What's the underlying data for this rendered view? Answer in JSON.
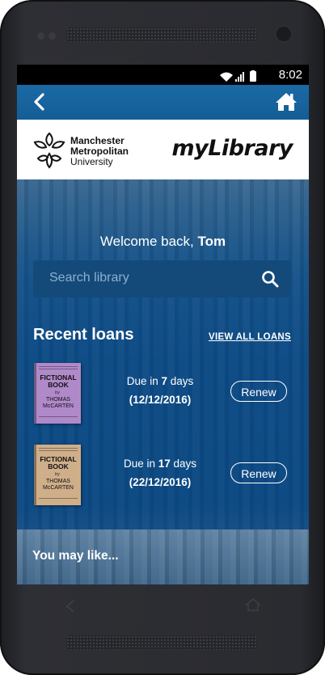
{
  "status_bar": {
    "time": "8:02"
  },
  "app_bar": {
    "back_icon": "chevron-left-icon",
    "home_icon": "home-icon"
  },
  "branding": {
    "university_line1": "Manchester",
    "university_line2": "Metropolitan",
    "university_line3": "University",
    "app_name": "myLibrary"
  },
  "welcome": {
    "prefix": "Welcome back, ",
    "name": "Tom"
  },
  "search": {
    "placeholder": "Search library"
  },
  "recent_loans": {
    "title": "Recent loans",
    "view_all_label": "VIEW ALL LOANS",
    "items": [
      {
        "book_title": "FICTIONAL BOOK",
        "book_by": "by",
        "book_author": "THOMAS McCARTEN",
        "cover_color": "#b089c9",
        "due_prefix": "Due in ",
        "due_count": "7",
        "due_suffix": " days",
        "due_date": "(12/12/2016)",
        "renew_label": "Renew"
      },
      {
        "book_title": "FICTIONAL BOOK",
        "book_by": "by",
        "book_author": "THOMAS McCARTEN",
        "cover_color": "#cfae8a",
        "due_prefix": "Due in ",
        "due_count": "17",
        "due_suffix": " days",
        "due_date": "(22/12/2016)",
        "renew_label": "Renew"
      }
    ]
  },
  "you_may_like": {
    "title": "You may like..."
  },
  "device_nav": {
    "back_icon": "nav-back-icon",
    "home_icon": "nav-home-icon"
  }
}
